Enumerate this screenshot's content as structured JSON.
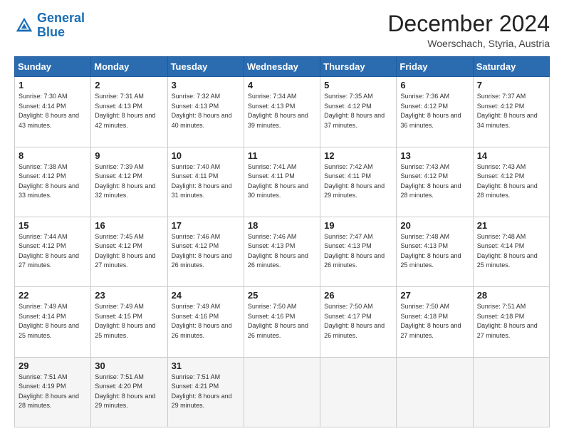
{
  "logo": {
    "line1": "General",
    "line2": "Blue"
  },
  "title": "December 2024",
  "subtitle": "Woerschach, Styria, Austria",
  "days_of_week": [
    "Sunday",
    "Monday",
    "Tuesday",
    "Wednesday",
    "Thursday",
    "Friday",
    "Saturday"
  ],
  "weeks": [
    [
      {
        "day": "1",
        "sunrise": "7:30 AM",
        "sunset": "4:14 PM",
        "daylight": "8 hours and 43 minutes."
      },
      {
        "day": "2",
        "sunrise": "7:31 AM",
        "sunset": "4:13 PM",
        "daylight": "8 hours and 42 minutes."
      },
      {
        "day": "3",
        "sunrise": "7:32 AM",
        "sunset": "4:13 PM",
        "daylight": "8 hours and 40 minutes."
      },
      {
        "day": "4",
        "sunrise": "7:34 AM",
        "sunset": "4:13 PM",
        "daylight": "8 hours and 39 minutes."
      },
      {
        "day": "5",
        "sunrise": "7:35 AM",
        "sunset": "4:12 PM",
        "daylight": "8 hours and 37 minutes."
      },
      {
        "day": "6",
        "sunrise": "7:36 AM",
        "sunset": "4:12 PM",
        "daylight": "8 hours and 36 minutes."
      },
      {
        "day": "7",
        "sunrise": "7:37 AM",
        "sunset": "4:12 PM",
        "daylight": "8 hours and 34 minutes."
      }
    ],
    [
      {
        "day": "8",
        "sunrise": "7:38 AM",
        "sunset": "4:12 PM",
        "daylight": "8 hours and 33 minutes."
      },
      {
        "day": "9",
        "sunrise": "7:39 AM",
        "sunset": "4:12 PM",
        "daylight": "8 hours and 32 minutes."
      },
      {
        "day": "10",
        "sunrise": "7:40 AM",
        "sunset": "4:11 PM",
        "daylight": "8 hours and 31 minutes."
      },
      {
        "day": "11",
        "sunrise": "7:41 AM",
        "sunset": "4:11 PM",
        "daylight": "8 hours and 30 minutes."
      },
      {
        "day": "12",
        "sunrise": "7:42 AM",
        "sunset": "4:11 PM",
        "daylight": "8 hours and 29 minutes."
      },
      {
        "day": "13",
        "sunrise": "7:43 AM",
        "sunset": "4:12 PM",
        "daylight": "8 hours and 28 minutes."
      },
      {
        "day": "14",
        "sunrise": "7:43 AM",
        "sunset": "4:12 PM",
        "daylight": "8 hours and 28 minutes."
      }
    ],
    [
      {
        "day": "15",
        "sunrise": "7:44 AM",
        "sunset": "4:12 PM",
        "daylight": "8 hours and 27 minutes."
      },
      {
        "day": "16",
        "sunrise": "7:45 AM",
        "sunset": "4:12 PM",
        "daylight": "8 hours and 27 minutes."
      },
      {
        "day": "17",
        "sunrise": "7:46 AM",
        "sunset": "4:12 PM",
        "daylight": "8 hours and 26 minutes."
      },
      {
        "day": "18",
        "sunrise": "7:46 AM",
        "sunset": "4:13 PM",
        "daylight": "8 hours and 26 minutes."
      },
      {
        "day": "19",
        "sunrise": "7:47 AM",
        "sunset": "4:13 PM",
        "daylight": "8 hours and 26 minutes."
      },
      {
        "day": "20",
        "sunrise": "7:48 AM",
        "sunset": "4:13 PM",
        "daylight": "8 hours and 25 minutes."
      },
      {
        "day": "21",
        "sunrise": "7:48 AM",
        "sunset": "4:14 PM",
        "daylight": "8 hours and 25 minutes."
      }
    ],
    [
      {
        "day": "22",
        "sunrise": "7:49 AM",
        "sunset": "4:14 PM",
        "daylight": "8 hours and 25 minutes."
      },
      {
        "day": "23",
        "sunrise": "7:49 AM",
        "sunset": "4:15 PM",
        "daylight": "8 hours and 25 minutes."
      },
      {
        "day": "24",
        "sunrise": "7:49 AM",
        "sunset": "4:16 PM",
        "daylight": "8 hours and 26 minutes."
      },
      {
        "day": "25",
        "sunrise": "7:50 AM",
        "sunset": "4:16 PM",
        "daylight": "8 hours and 26 minutes."
      },
      {
        "day": "26",
        "sunrise": "7:50 AM",
        "sunset": "4:17 PM",
        "daylight": "8 hours and 26 minutes."
      },
      {
        "day": "27",
        "sunrise": "7:50 AM",
        "sunset": "4:18 PM",
        "daylight": "8 hours and 27 minutes."
      },
      {
        "day": "28",
        "sunrise": "7:51 AM",
        "sunset": "4:18 PM",
        "daylight": "8 hours and 27 minutes."
      }
    ],
    [
      {
        "day": "29",
        "sunrise": "7:51 AM",
        "sunset": "4:19 PM",
        "daylight": "8 hours and 28 minutes."
      },
      {
        "day": "30",
        "sunrise": "7:51 AM",
        "sunset": "4:20 PM",
        "daylight": "8 hours and 29 minutes."
      },
      {
        "day": "31",
        "sunrise": "7:51 AM",
        "sunset": "4:21 PM",
        "daylight": "8 hours and 29 minutes."
      },
      null,
      null,
      null,
      null
    ]
  ]
}
